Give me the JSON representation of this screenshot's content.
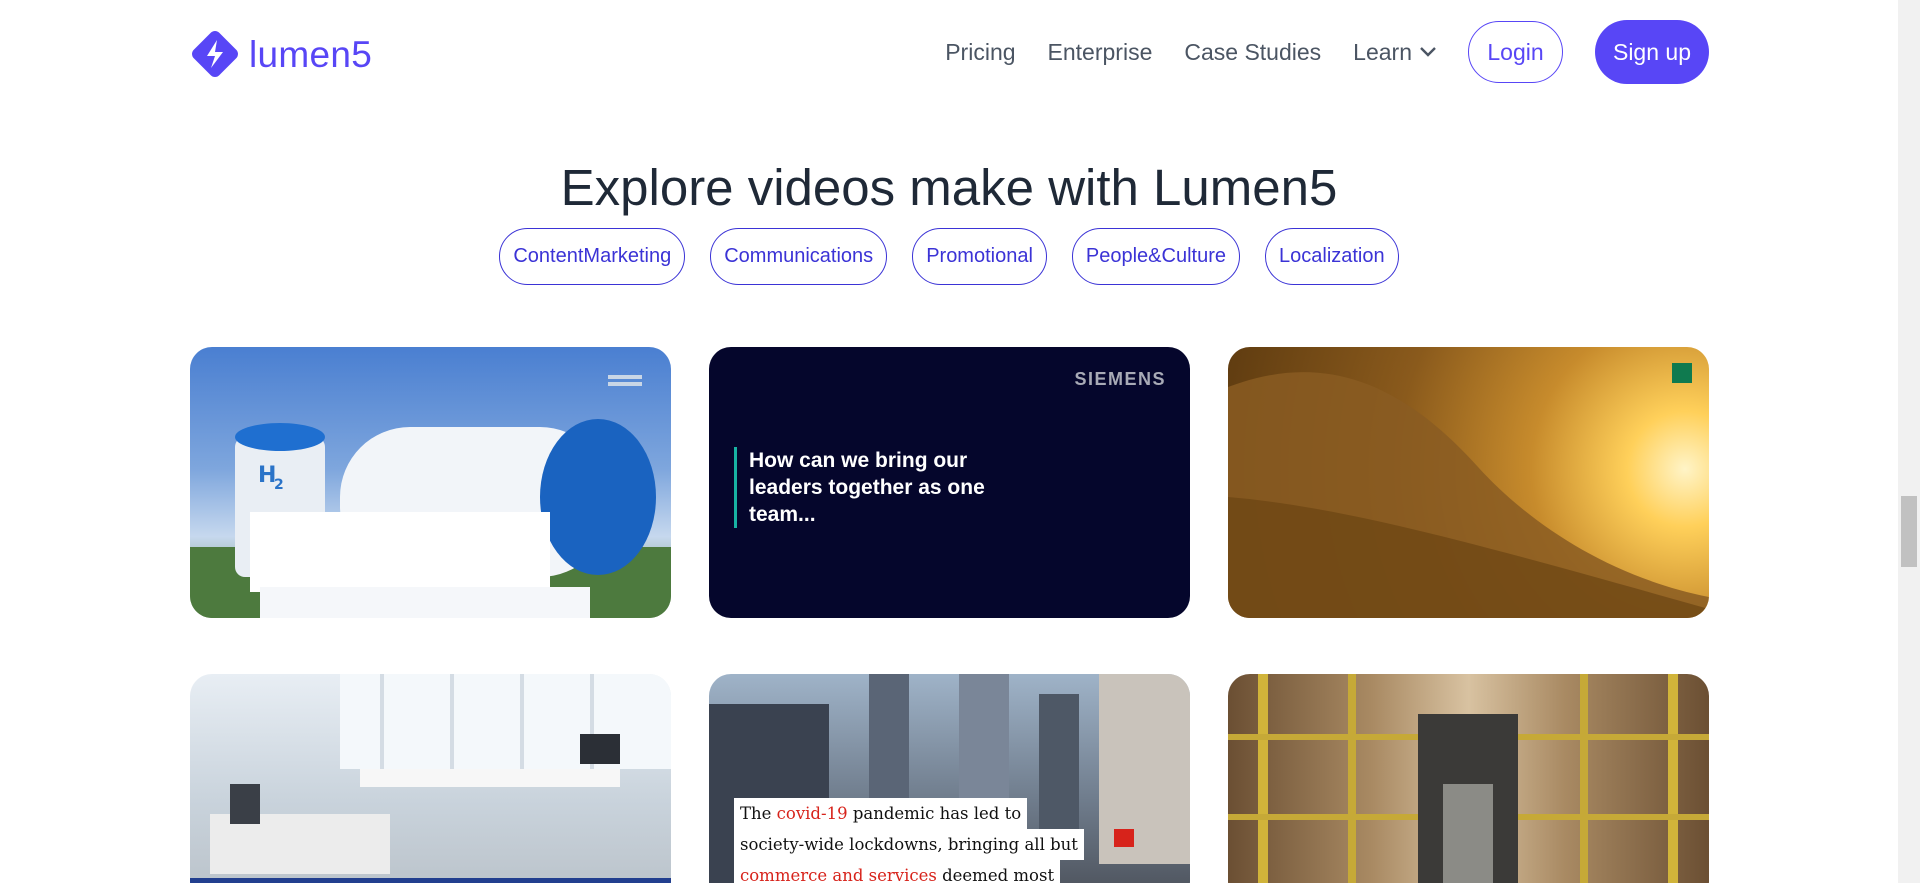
{
  "brand": {
    "name": "lumen5",
    "accent_color": "#5846f6"
  },
  "nav": {
    "links": [
      "Pricing",
      "Enterprise",
      "Case Studies",
      "Learn"
    ],
    "login": "Login",
    "signup": "Sign up"
  },
  "heading": "Explore videos make with Lumen5",
  "filters": [
    "ContentMarketing",
    "Communications",
    "Promotional",
    "People&Culture",
    "Localization"
  ],
  "cards": {
    "siemens": {
      "logo_text": "SIEMENS",
      "quote": "How can we bring our leaders together as one team..."
    },
    "news": {
      "line1_pre": "The ",
      "line1_hl": "covid-19",
      "line1_post": " pandemic has led to",
      "line2": "society-wide lockdowns, bringing all but",
      "line3_hl": "commerce and services",
      "line3_post": " deemed most"
    }
  }
}
